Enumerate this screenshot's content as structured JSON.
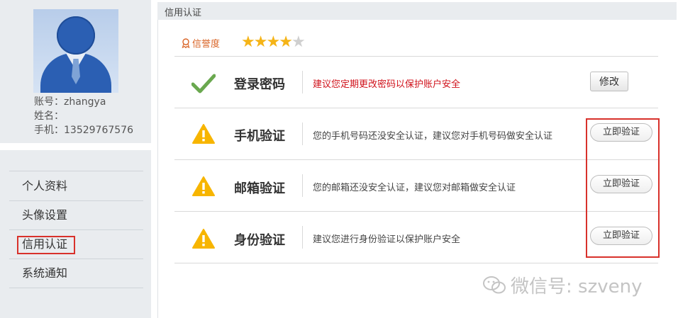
{
  "profile": {
    "account": "账号：zhangya",
    "name": "姓名：",
    "phone": "手机：13529767576"
  },
  "sidebar": {
    "items": [
      {
        "label": "个人资料"
      },
      {
        "label": "头像设置"
      },
      {
        "label": "信用认证"
      },
      {
        "label": "系统通知"
      }
    ],
    "active_index": 2
  },
  "main": {
    "header_title": "信用认证",
    "credit": {
      "label": "信誉度",
      "rating": 4,
      "max_rating": 5,
      "star_color": "#f5b417"
    },
    "rows": [
      {
        "icon": "checkmark-icon",
        "title": "登录密码",
        "description": "建议您定期更改密码以保护账户安全",
        "description_color": "#d0121b",
        "action": "修改"
      },
      {
        "icon": "warning-icon",
        "title": "手机验证",
        "description": "您的手机号码还没安全认证，建议您对手机号码做安全认证",
        "action": "立即验证"
      },
      {
        "icon": "warning-icon",
        "title": "邮箱验证",
        "description": "您的邮箱还没安全认证，建议您对邮箱做安全认证",
        "action": "立即验证"
      },
      {
        "icon": "warning-icon",
        "title": "身份验证",
        "description": "建议您进行身份验证以保护账户安全",
        "action": "立即验证"
      }
    ]
  },
  "watermark": {
    "text": "微信号: szveny"
  },
  "colors": {
    "highlight": "#d8312b",
    "panel_bg": "#e9ecef",
    "warning": "#f7b500",
    "check": "#6aa84f"
  }
}
